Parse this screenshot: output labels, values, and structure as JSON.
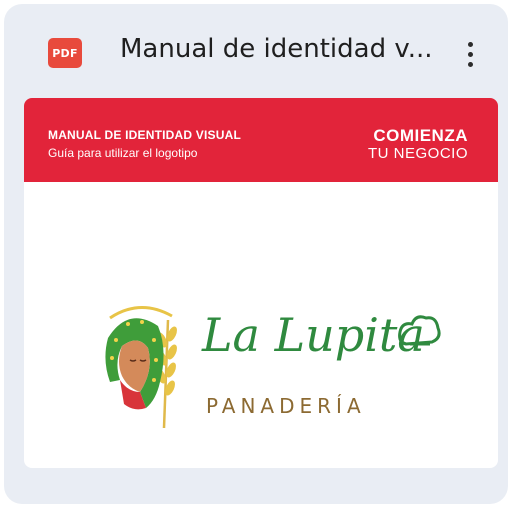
{
  "file": {
    "type_badge": "PDF",
    "title": "Manual de identidad v...",
    "more_icon": "more-vert-icon"
  },
  "preview": {
    "banner": {
      "title": "MANUAL DE IDENTIDAD VISUAL",
      "subtitle": "Guía para utilizar el logotipo",
      "brand_line1": "COMIENZA",
      "brand_line2": "TU NEGOCIO",
      "color": "#e2243a"
    },
    "logo": {
      "name": "La Lupita",
      "subtitle": "PANADERÍA",
      "name_color": "#2f8a3f",
      "subtitle_color": "#8c6a32"
    }
  }
}
